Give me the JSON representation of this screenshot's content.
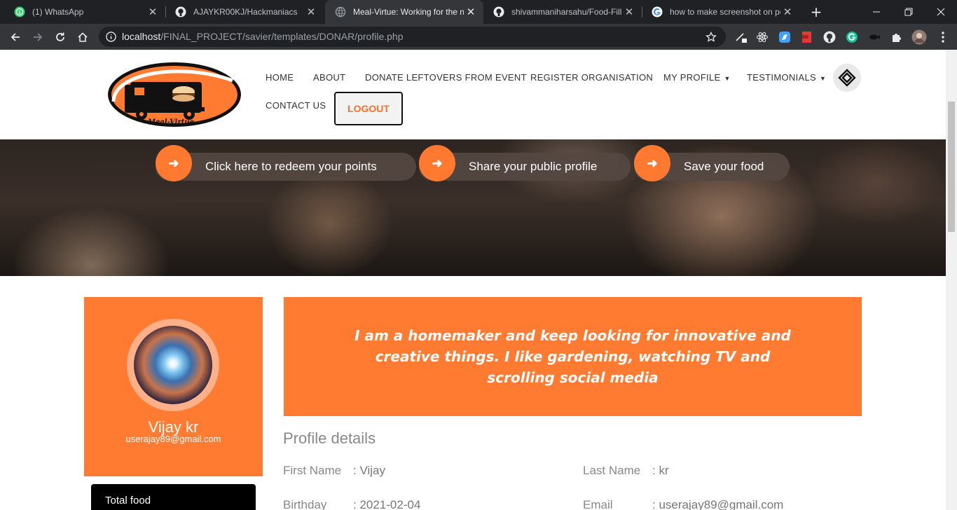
{
  "browser": {
    "tabs": [
      {
        "title": "(1) WhatsApp",
        "favicon": "whatsapp-icon"
      },
      {
        "title": "AJAYKR00KJ/Hackmaniacs",
        "favicon": "github-icon"
      },
      {
        "title": "Meal-Virtue: Working for the n",
        "favicon": "globe-icon",
        "active": true
      },
      {
        "title": "shivammaniharsahu/Food-Fille",
        "favicon": "github-icon"
      },
      {
        "title": "how to make screenshot on pc",
        "favicon": "google-icon"
      }
    ],
    "close_glyph": "✕",
    "new_tab_glyph": "+",
    "url_host": "localhost",
    "url_path": "/FINAL_PROJECT/savier/templates/DONAR/profile.php",
    "colors": {
      "frame": "#202124",
      "toolbar": "#35363a"
    }
  },
  "site": {
    "logo_text": "Meal-Virtue",
    "nav": {
      "home": "HOME",
      "about": "ABOUT",
      "donate": "DONATE LEFTOVERS FROM EVENT",
      "register": "REGISTER ORGANISATION",
      "my_profile": "MY PROFILE",
      "testimonials": "TESTIMONIALS",
      "contact": "CONTACT US",
      "logout": "LOGOUT"
    },
    "accent_color": "#ff7b31"
  },
  "hero": {
    "actions": [
      {
        "label": "Click here to redeem your points",
        "icon": "arrow-right-icon"
      },
      {
        "label": "Share your public profile",
        "icon": "arrow-right-icon"
      },
      {
        "label": "Save your food",
        "icon": "arrow-right-icon"
      }
    ]
  },
  "profile": {
    "name": "Vijay kr",
    "email": "userajay89@gmail.com",
    "about": "I am a homemaker and keep looking for innovative and creative things. I like gardening, watching TV and scrolling social media",
    "stat_label": "Total food",
    "details_heading": "Profile details",
    "fields": {
      "first_name_label": "First Name",
      "first_name_value": ": Vijay",
      "last_name_label": "Last Name",
      "last_name_value": ": kr",
      "birthday_label": "Birthday",
      "birthday_value": ": 2021-02-04",
      "email_label": "Email",
      "email_value": ": userajay89@gmail.com"
    }
  }
}
